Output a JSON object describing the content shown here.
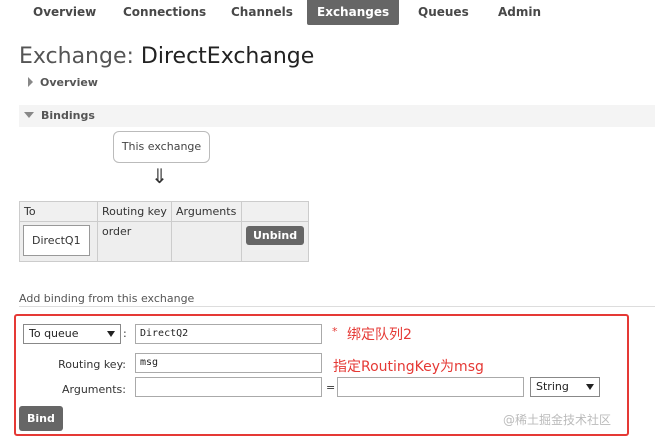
{
  "nav": {
    "tabs": [
      {
        "label": "Overview"
      },
      {
        "label": "Connections"
      },
      {
        "label": "Channels"
      },
      {
        "label": "Exchanges",
        "active": true
      },
      {
        "label": "Queues"
      },
      {
        "label": "Admin"
      }
    ]
  },
  "page": {
    "title_label": "Exchange:",
    "title_name": "DirectExchange"
  },
  "sections": {
    "overview": "Overview",
    "bindings": "Bindings"
  },
  "diagram": {
    "this_exchange": "This exchange",
    "arrow": "⇓"
  },
  "bindings_table": {
    "headers": [
      "To",
      "Routing key",
      "Arguments",
      ""
    ],
    "rows": [
      {
        "to": "DirectQ1",
        "routing_key": "order",
        "arguments": "",
        "action": "Unbind"
      }
    ]
  },
  "add_binding": {
    "title": "Add binding from this exchange",
    "destination_type": "To queue",
    "destination_colon": ":",
    "destination_value": "DirectQ2",
    "required_mark": "*",
    "routing_key_label": "Routing key:",
    "routing_key_value": "msg",
    "arguments_label": "Arguments:",
    "arguments_eq": "=",
    "arguments_key": "",
    "arguments_value": "",
    "arguments_type": "String",
    "bind_label": "Bind"
  },
  "annotations": {
    "queue_note": "绑定队列2",
    "routing_note": "指定RoutingKey为msg"
  },
  "watermark": "@稀土掘金技术社区",
  "colors": {
    "nav_active_bg": "#666666",
    "highlight_red": "#e53935",
    "button_bg": "#666666"
  }
}
